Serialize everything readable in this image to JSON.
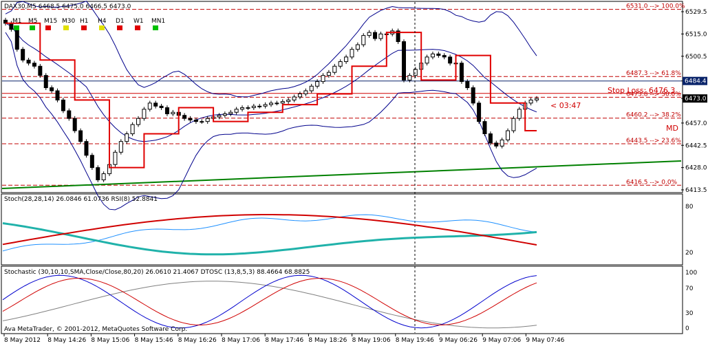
{
  "header": {
    "symbol": "DAX30,M5",
    "ohlc": "6468.5 6475.0 6466.5 6473.0"
  },
  "timeframes": [
    {
      "label": "M1",
      "color": "#00c000"
    },
    {
      "label": "M5",
      "color": "#00c000"
    },
    {
      "label": "M15",
      "color": "#e00000"
    },
    {
      "label": "M30",
      "color": "#e0e000"
    },
    {
      "label": "H1",
      "color": "#e00000"
    },
    {
      "label": "H4",
      "color": "#e0e000"
    },
    {
      "label": "D1",
      "color": "#e00000"
    },
    {
      "label": "W1",
      "color": "#e00000"
    },
    {
      "label": "MN1",
      "color": "#00c000"
    }
  ],
  "price_axis": [
    "6529.5",
    "6515.0",
    "6500.5",
    "6484.4",
    "6473.0",
    "6457.0",
    "6442.5",
    "6428.0",
    "6413.5"
  ],
  "price_axis_values": [
    6529.5,
    6515.0,
    6500.5,
    6484.4,
    6473.0,
    6457.0,
    6442.5,
    6428.0,
    6413.5
  ],
  "current_price": "6473.0",
  "line_price": "6484.4",
  "fib_levels": [
    {
      "label": "6531.0 --> 100.0%",
      "price": 6531.0
    },
    {
      "label": "6487.3 --> 61.8%",
      "price": 6487.3
    },
    {
      "label": "6473.8 --> 50.0%",
      "price": 6473.8
    },
    {
      "label": "6460.2 --> 38.2%",
      "price": 6460.2
    },
    {
      "label": "6443.5 --> 23.6%",
      "price": 6443.5
    },
    {
      "label": "6416.5 --> 0.0%",
      "price": 6416.5
    }
  ],
  "annotations": {
    "stop_loss": "Stop Loss: 6476.3",
    "countdown": "< 03:47",
    "md": "MD"
  },
  "stoch1": {
    "title": "Stoch(28,28,14) 26.0846 61.0736",
    "rsi": "RSI(8) 52.8841",
    "axis": [
      "80",
      "20"
    ]
  },
  "stoch2": {
    "title": "Stochastic (30,10,10,SMA,Close/Close,80,20) 26.0610 21.4067",
    "dtosc": "DTOSC (13,8,5,3) 88.4664 68.8825",
    "axis": [
      "100",
      "70",
      "30",
      "0"
    ]
  },
  "copyright": "Ava MetaTrader, © 2001-2012, MetaQuotes Software Corp.",
  "time_axis": [
    "8 May 2012",
    "8 May 14:26",
    "8 May 15:06",
    "8 May 15:46",
    "8 May 16:26",
    "8 May 17:06",
    "8 May 17:46",
    "8 May 18:26",
    "8 May 19:06",
    "8 May 19:46",
    "9 May 06:26",
    "9 May 07:06",
    "9 May 07:46"
  ],
  "chart_data": {
    "type": "candlestick",
    "title": "DAX30,M5",
    "ylim": [
      6410,
      6535
    ],
    "close": [
      6522,
      6518,
      6505,
      6498,
      6496,
      6494,
      6488,
      6480,
      6478,
      6472,
      6465,
      6460,
      6452,
      6445,
      6436,
      6428,
      6420,
      6424,
      6430,
      6438,
      6445,
      6450,
      6456,
      6460,
      6466,
      6470,
      6468,
      6467,
      6463,
      6464,
      6462,
      6460,
      6459,
      6458,
      6458,
      6460,
      6461,
      6462,
      6463,
      6464,
      6466,
      6467,
      6467,
      6468,
      6468,
      6469,
      6470,
      6470,
      6471,
      6472,
      6474,
      6476,
      6478,
      6481,
      6484,
      6488,
      6490,
      6494,
      6497,
      6500,
      6505,
      6508,
      6514,
      6516,
      6512,
      6515,
      6515,
      6517,
      6510,
      6485,
      6488,
      6492,
      6496,
      6500,
      6502,
      6501,
      6500,
      6496,
      6496,
      6484,
      6480,
      6470,
      6458,
      6450,
      6444,
      6442,
      6446,
      6452,
      6460,
      6466,
      6470,
      6472,
      6473
    ]
  }
}
